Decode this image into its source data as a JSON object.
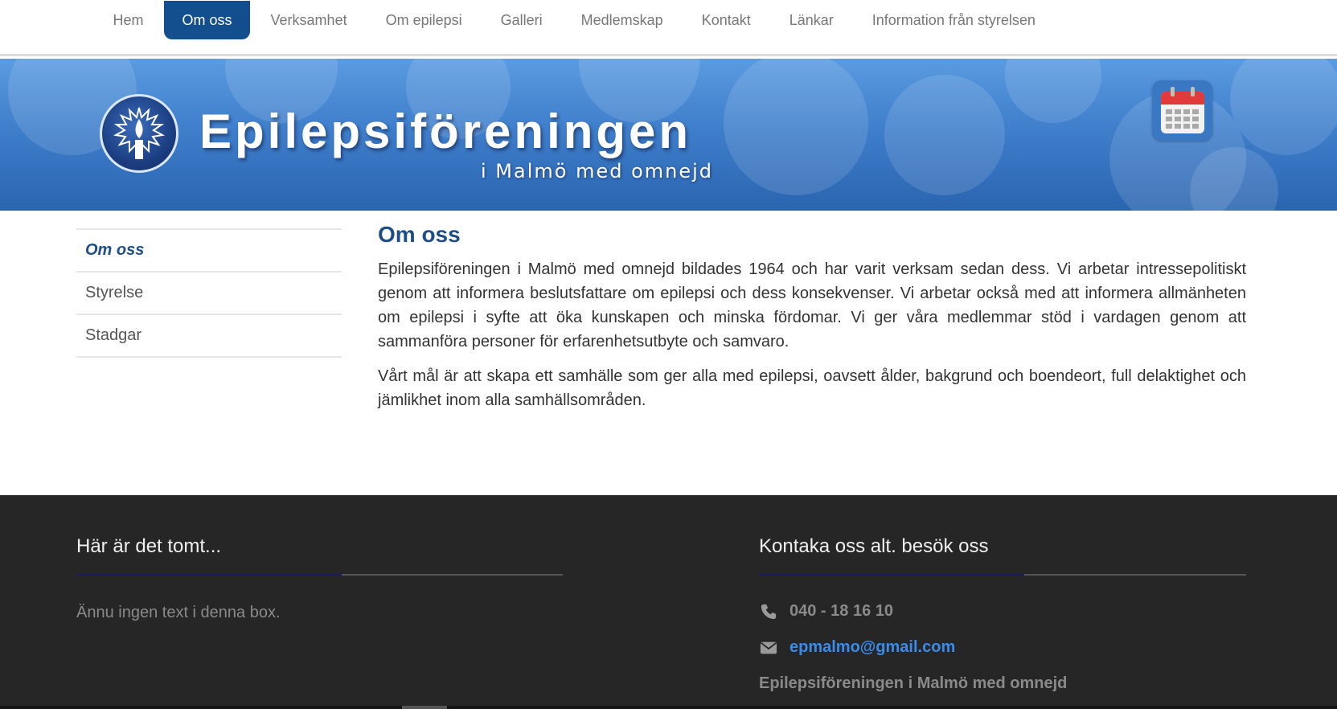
{
  "nav": {
    "items": [
      {
        "label": "Hem",
        "active": false
      },
      {
        "label": "Om oss",
        "active": true
      },
      {
        "label": "Verksamhet",
        "active": false
      },
      {
        "label": "Om epilepsi",
        "active": false
      },
      {
        "label": "Galleri",
        "active": false
      },
      {
        "label": "Medlemskap",
        "active": false
      },
      {
        "label": "Kontakt",
        "active": false
      },
      {
        "label": "Länkar",
        "active": false
      },
      {
        "label": "Information från styrelsen",
        "active": false
      }
    ]
  },
  "banner": {
    "title": "Epilepsiföreningen",
    "subtitle": "i Malmö med omnejd",
    "calendar_icon": "calendar-icon",
    "logo_icon": "candle-emblem-icon"
  },
  "sidebar": {
    "items": [
      {
        "label": "Om oss",
        "active": true
      },
      {
        "label": "Styrelse",
        "active": false
      },
      {
        "label": "Stadgar",
        "active": false
      }
    ]
  },
  "main": {
    "heading": "Om oss",
    "paragraphs": [
      "Epilepsiföreningen i Malmö med omnejd bildades 1964 och har varit verksam sedan dess. Vi arbetar intressepolitiskt genom att informera beslutsfattare om epilepsi och dess konsekvenser. Vi arbetar också med att informera allmänheten om epilepsi i syfte att öka kunskapen och minska fördomar. Vi ger våra medlemmar stöd i vardagen genom att sammanföra personer för erfarenhetsutbyte och samvaro.",
      "Vårt mål är att skapa ett samhälle som ger alla med epilepsi, oavsett ålder, bakgrund och boendeort, full delaktighet och jämlikhet inom alla samhällsområden."
    ]
  },
  "footer": {
    "left": {
      "heading": "Här är det tomt...",
      "text": "Ännu ingen text i denna box."
    },
    "right": {
      "heading": "Kontaka oss alt. besök oss",
      "phone": "040 - 18 16 10",
      "email": "epmalmo@gmail.com",
      "org": "Epilepsiföreningen i Malmö med omnejd",
      "phone_icon": "phone-icon",
      "email_icon": "envelope-icon"
    }
  },
  "colors": {
    "nav_active": "#134f8f",
    "heading": "#1f4e86",
    "footer_bg": "#262626",
    "link": "#3b8be8"
  }
}
